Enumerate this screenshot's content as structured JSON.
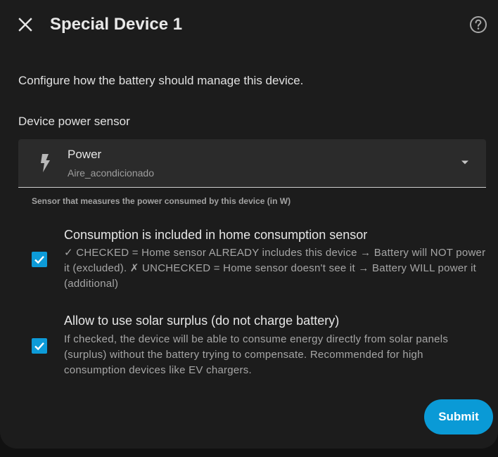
{
  "dialog": {
    "title": "Special Device 1",
    "close_icon": "close-icon",
    "help_icon": "help-circle-icon",
    "description": "Configure how the battery should manage this device."
  },
  "sensor_field": {
    "label": "Device power sensor",
    "icon": "lightning-bolt-icon",
    "selected_name": "Power",
    "selected_entity": "Aire_acondicionado",
    "helper_text": "Sensor that measures the power consumed by this device (in W)"
  },
  "options": [
    {
      "checked": true,
      "title": "Consumption is included in home consumption sensor",
      "description": "✓ CHECKED = Home sensor ALREADY includes this device → Battery will NOT power it (excluded). ✗ UNCHECKED = Home sensor doesn't see it → Battery WILL power it (additional)"
    },
    {
      "checked": true,
      "title": "Allow to use solar surplus (do not charge battery)",
      "description": "If checked, the device will be able to consume energy directly from solar panels (surplus) without the battery trying to compensate. Recommended for high consumption devices like EV chargers."
    }
  ],
  "actions": {
    "submit_label": "Submit"
  },
  "colors": {
    "accent": "#0a9ad6",
    "dialog_bg": "#1c1c1c",
    "field_bg": "#2b2b2b"
  }
}
